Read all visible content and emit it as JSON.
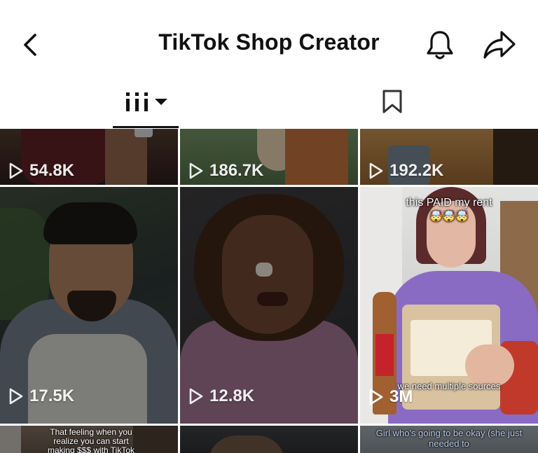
{
  "header": {
    "title": "TikTok Shop Creator"
  },
  "tabs": [
    {
      "name": "videos",
      "icon": "grid-bars-icon",
      "active": true
    },
    {
      "name": "saved",
      "icon": "bookmark-icon",
      "active": false
    }
  ],
  "videos": [
    {
      "views": "54.8K"
    },
    {
      "views": "186.7K"
    },
    {
      "views": "192.2K"
    },
    {
      "views": "17.5K"
    },
    {
      "views": "12.8K"
    },
    {
      "views": "3M",
      "caption_top": "this PAID my rent",
      "caption_emoji": "🤯🤯🤯",
      "caption_bottom": "we need multiple sources"
    },
    {
      "caption": "That feeling when you realize you can start making $$$ with TikTok"
    },
    {},
    {
      "caption": "Girl who's going to be okay (she just needed to"
    }
  ],
  "colors": {
    "text_primary": "#111111",
    "overlay_text": "#ffffff",
    "underline": "#111111"
  }
}
